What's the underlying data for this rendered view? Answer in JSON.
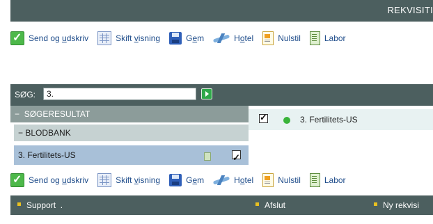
{
  "header": {
    "title": "REKVISITI"
  },
  "toolbar": {
    "send": {
      "pre": "Send og ",
      "u": "u",
      "post": "dskriv"
    },
    "skift": {
      "pre": "Skift ",
      "u": "v",
      "post": "isning"
    },
    "gem": {
      "pre": "G",
      "u": "e",
      "post": "m"
    },
    "hotel": {
      "pre": "H",
      "u": "o",
      "post": "tel"
    },
    "nulstil": "Nulstil",
    "labor": "Labor"
  },
  "search": {
    "label": "SØG:",
    "value": "3."
  },
  "results": {
    "header": "SØGERESULTAT",
    "group": "BLODBANK",
    "item": "3. Fertilitets-US",
    "item_checked": true
  },
  "detail": {
    "text": "3. Fertilitets-US",
    "status_color": "#3ab43a",
    "checked": true
  },
  "footer": {
    "support": "Support",
    "support_suffix": ".",
    "afslut": "Afslut",
    "ny": "Ny rekvisi"
  },
  "colors": {
    "bar": "#4c5f5f",
    "link": "#1e4c8a",
    "accent": "#3ab43a"
  }
}
